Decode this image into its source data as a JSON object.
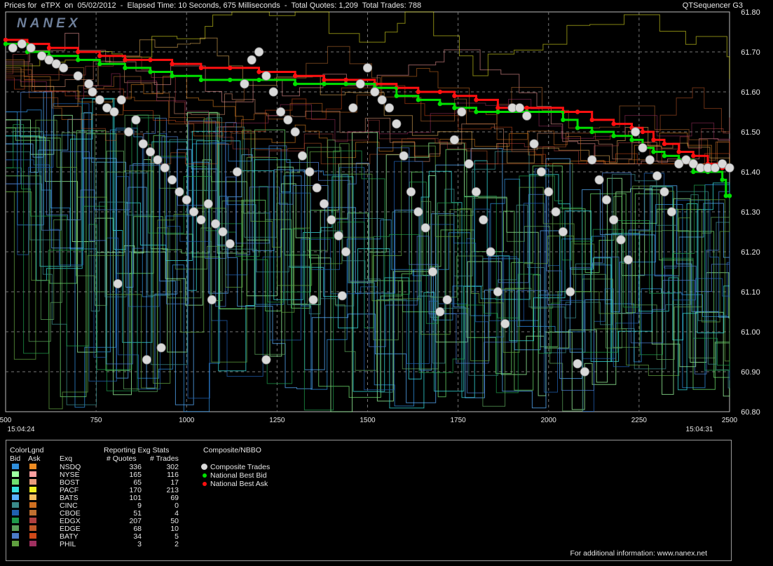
{
  "header": {
    "title": "Prices for  eTPX  on  05/02/2012  -  Elapsed Time: 10 Seconds, 675 Milliseconds  -  Total Quotes: 1,209  Total Trades: 788",
    "app": "QTSequencer G3",
    "logo": "NANEX"
  },
  "chart_data": {
    "type": "scatter",
    "title": "Prices for  eTPX  on  05/02/2012  -  Elapsed Time: 10 Seconds, 675 Milliseconds  -  Total Quotes: 1,209  Total Trades: 788",
    "x_ticks": [
      500,
      750,
      1000,
      1250,
      1500,
      1750,
      2000,
      2250,
      2500
    ],
    "x_time_labels": {
      "start": "15:04:24",
      "end": "15:04:31"
    },
    "xlim": [
      500,
      2500
    ],
    "y_ticks": [
      "60.80",
      "60.90",
      "61.00",
      "61.10",
      "61.20",
      "61.30",
      "61.40",
      "61.50",
      "61.60",
      "61.70",
      "61.80"
    ],
    "ylim": [
      60.8,
      61.8
    ],
    "grid": true,
    "national_best_ask": [
      [
        500,
        61.73
      ],
      [
        560,
        61.72
      ],
      [
        620,
        61.71
      ],
      [
        700,
        61.7
      ],
      [
        760,
        61.69
      ],
      [
        830,
        61.68
      ],
      [
        900,
        61.68
      ],
      [
        960,
        61.67
      ],
      [
        1040,
        61.66
      ],
      [
        1120,
        61.66
      ],
      [
        1200,
        61.65
      ],
      [
        1300,
        61.64
      ],
      [
        1380,
        61.63
      ],
      [
        1440,
        61.63
      ],
      [
        1520,
        61.62
      ],
      [
        1580,
        61.61
      ],
      [
        1640,
        61.6
      ],
      [
        1700,
        61.6
      ],
      [
        1740,
        61.59
      ],
      [
        1800,
        61.58
      ],
      [
        1860,
        61.56
      ],
      [
        1940,
        61.56
      ],
      [
        2040,
        61.55
      ],
      [
        2080,
        61.55
      ],
      [
        2120,
        61.53
      ],
      [
        2180,
        61.52
      ],
      [
        2230,
        61.51
      ],
      [
        2260,
        61.5
      ],
      [
        2290,
        61.48
      ],
      [
        2320,
        61.47
      ],
      [
        2360,
        61.45
      ],
      [
        2400,
        61.44
      ],
      [
        2440,
        61.42
      ],
      [
        2480,
        61.41
      ],
      [
        2500,
        61.41
      ]
    ],
    "national_best_bid": [
      [
        500,
        61.72
      ],
      [
        560,
        61.7
      ],
      [
        620,
        61.69
      ],
      [
        700,
        61.68
      ],
      [
        760,
        61.67
      ],
      [
        830,
        61.66
      ],
      [
        900,
        61.65
      ],
      [
        960,
        61.64
      ],
      [
        1040,
        61.63
      ],
      [
        1120,
        61.63
      ],
      [
        1200,
        61.63
      ],
      [
        1300,
        61.62
      ],
      [
        1380,
        61.62
      ],
      [
        1440,
        61.62
      ],
      [
        1520,
        61.61
      ],
      [
        1580,
        61.59
      ],
      [
        1640,
        61.58
      ],
      [
        1700,
        61.57
      ],
      [
        1740,
        61.56
      ],
      [
        1800,
        61.55
      ],
      [
        1860,
        61.55
      ],
      [
        1940,
        61.55
      ],
      [
        2040,
        61.53
      ],
      [
        2080,
        61.51
      ],
      [
        2120,
        61.5
      ],
      [
        2180,
        61.49
      ],
      [
        2230,
        61.48
      ],
      [
        2260,
        61.46
      ],
      [
        2290,
        61.45
      ],
      [
        2320,
        61.44
      ],
      [
        2360,
        61.43
      ],
      [
        2400,
        61.4
      ],
      [
        2440,
        61.4
      ],
      [
        2480,
        61.38
      ],
      [
        2490,
        61.34
      ],
      [
        2500,
        61.34
      ]
    ],
    "composite_trades": [
      [
        520,
        61.71
      ],
      [
        545,
        61.72
      ],
      [
        570,
        61.71
      ],
      [
        600,
        61.69
      ],
      [
        620,
        61.68
      ],
      [
        640,
        61.67
      ],
      [
        660,
        61.66
      ],
      [
        700,
        61.64
      ],
      [
        730,
        61.62
      ],
      [
        740,
        61.6
      ],
      [
        760,
        61.58
      ],
      [
        780,
        61.56
      ],
      [
        800,
        61.55
      ],
      [
        820,
        61.58
      ],
      [
        840,
        61.5
      ],
      [
        860,
        61.53
      ],
      [
        880,
        61.47
      ],
      [
        900,
        61.45
      ],
      [
        920,
        61.43
      ],
      [
        940,
        61.41
      ],
      [
        960,
        61.38
      ],
      [
        980,
        61.35
      ],
      [
        1000,
        61.33
      ],
      [
        1020,
        61.3
      ],
      [
        1040,
        61.28
      ],
      [
        1060,
        61.32
      ],
      [
        1080,
        61.27
      ],
      [
        1100,
        61.25
      ],
      [
        1120,
        61.22
      ],
      [
        1140,
        61.4
      ],
      [
        1160,
        61.62
      ],
      [
        1180,
        61.68
      ],
      [
        1200,
        61.7
      ],
      [
        1220,
        61.64
      ],
      [
        1240,
        61.6
      ],
      [
        1260,
        61.55
      ],
      [
        1280,
        61.53
      ],
      [
        1300,
        61.5
      ],
      [
        1320,
        61.44
      ],
      [
        1340,
        61.4
      ],
      [
        1360,
        61.36
      ],
      [
        1380,
        61.32
      ],
      [
        1400,
        61.28
      ],
      [
        1420,
        61.24
      ],
      [
        1440,
        61.2
      ],
      [
        1460,
        61.56
      ],
      [
        1480,
        61.62
      ],
      [
        1500,
        61.66
      ],
      [
        1520,
        61.6
      ],
      [
        1540,
        61.58
      ],
      [
        1560,
        61.56
      ],
      [
        1580,
        61.52
      ],
      [
        1600,
        61.44
      ],
      [
        1620,
        61.35
      ],
      [
        1640,
        61.3
      ],
      [
        1660,
        61.26
      ],
      [
        1680,
        61.15
      ],
      [
        1700,
        61.05
      ],
      [
        1720,
        61.08
      ],
      [
        1740,
        61.48
      ],
      [
        1760,
        61.55
      ],
      [
        1780,
        61.42
      ],
      [
        1800,
        61.35
      ],
      [
        1820,
        61.28
      ],
      [
        1840,
        61.2
      ],
      [
        1860,
        61.1
      ],
      [
        1880,
        61.02
      ],
      [
        1900,
        61.56
      ],
      [
        1920,
        61.56
      ],
      [
        1940,
        61.54
      ],
      [
        1960,
        61.47
      ],
      [
        1980,
        61.4
      ],
      [
        2000,
        61.35
      ],
      [
        2020,
        61.3
      ],
      [
        2040,
        61.25
      ],
      [
        2060,
        61.1
      ],
      [
        2080,
        60.92
      ],
      [
        2100,
        60.9
      ],
      [
        2120,
        61.43
      ],
      [
        2140,
        61.38
      ],
      [
        2160,
        61.33
      ],
      [
        2180,
        61.28
      ],
      [
        2200,
        61.23
      ],
      [
        2220,
        61.18
      ],
      [
        2240,
        61.5
      ],
      [
        2260,
        61.46
      ],
      [
        2280,
        61.43
      ],
      [
        2300,
        61.39
      ],
      [
        2320,
        61.35
      ],
      [
        2340,
        61.3
      ],
      [
        2360,
        61.42
      ],
      [
        2380,
        61.43
      ],
      [
        2400,
        61.42
      ],
      [
        2420,
        61.41
      ],
      [
        2440,
        61.41
      ],
      [
        2460,
        61.41
      ],
      [
        2480,
        61.42
      ],
      [
        2500,
        61.41
      ],
      [
        810,
        61.12
      ],
      [
        890,
        60.93
      ],
      [
        930,
        60.96
      ],
      [
        1070,
        61.08
      ],
      [
        1220,
        60.93
      ],
      [
        1350,
        61.08
      ],
      [
        1430,
        61.09
      ]
    ]
  },
  "legend": {
    "color_lgnd": "ColorLgnd",
    "bid": "Bid",
    "ask": "Ask",
    "exq": "Exq",
    "reporting_header": "Reporting Exg Stats",
    "quotes_header": "# Quotes",
    "trades_header": "# Trades",
    "composite_header": "Composite/NBBO",
    "exchanges": [
      {
        "name": "NSDQ",
        "quotes": "336",
        "trades": "302",
        "bid_color": "#2f8fdd",
        "ask_color": "#ee8c22"
      },
      {
        "name": "NYSE",
        "quotes": "165",
        "trades": "116",
        "bid_color": "#9dffa0",
        "ask_color": "#ffa0a0"
      },
      {
        "name": "BOST",
        "quotes": "65",
        "trades": "17",
        "bid_color": "#6fdf6f",
        "ask_color": "#e89c7c"
      },
      {
        "name": "PACF",
        "quotes": "170",
        "trades": "213",
        "bid_color": "#37e0e0",
        "ask_color": "#f0f020"
      },
      {
        "name": "BATS",
        "quotes": "101",
        "trades": "69",
        "bid_color": "#58b0ff",
        "ask_color": "#f7c060"
      },
      {
        "name": "CINC",
        "quotes": "9",
        "trades": "0",
        "bid_color": "#3a8a8a",
        "ask_color": "#d07020"
      },
      {
        "name": "CBOE",
        "quotes": "51",
        "trades": "4",
        "bid_color": "#2060b0",
        "ask_color": "#c07030"
      },
      {
        "name": "EDGX",
        "quotes": "207",
        "trades": "50",
        "bid_color": "#1f9a4a",
        "ask_color": "#b04040"
      },
      {
        "name": "EDGE",
        "quotes": "68",
        "trades": "10",
        "bid_color": "#5aa05a",
        "ask_color": "#c05828"
      },
      {
        "name": "BATY",
        "quotes": "34",
        "trades": "5",
        "bid_color": "#4a7ac8",
        "ask_color": "#d04818"
      },
      {
        "name": "PHIL",
        "quotes": "3",
        "trades": "2",
        "bid_color": "#5f9f3f",
        "ask_color": "#a03060"
      }
    ],
    "composite": [
      {
        "label": "Composite Trades",
        "color": "#d8d8d8"
      },
      {
        "label": "National Best Bid",
        "color": "#00e000"
      },
      {
        "label": "National Best Ask",
        "color": "#ff1010"
      }
    ],
    "footer": "For additional information: www.nanex.net"
  }
}
